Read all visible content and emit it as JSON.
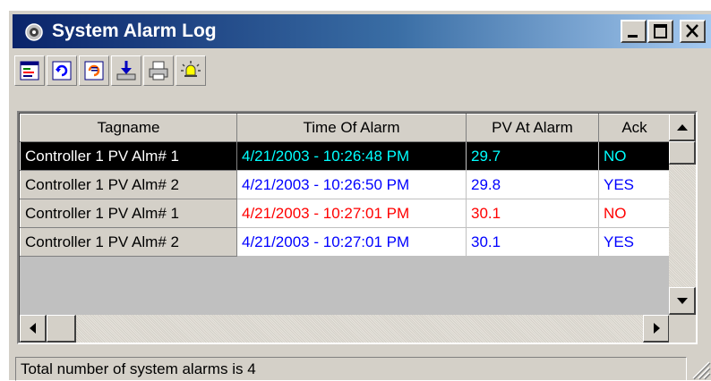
{
  "window": {
    "title": "System Alarm Log",
    "controls": [
      "minimize",
      "restore",
      "close"
    ]
  },
  "toolbar": {
    "buttons": [
      {
        "icon": "report-icon"
      },
      {
        "icon": "refresh-icon"
      },
      {
        "icon": "acknowledge-icon"
      },
      {
        "icon": "export-icon"
      },
      {
        "icon": "print-icon"
      },
      {
        "icon": "alarm-bell-icon"
      }
    ]
  },
  "grid": {
    "columns": [
      "Tagname",
      "Time Of Alarm",
      "PV At Alarm",
      "Ack"
    ],
    "rows": [
      {
        "tagname": "Controller 1 PV Alm# 1",
        "time": "4/21/2003 - 10:26:48 PM",
        "pv": "29.7",
        "ack": "NO",
        "color": "#00ffff",
        "selected": true
      },
      {
        "tagname": "Controller 1 PV Alm# 2",
        "time": "4/21/2003 - 10:26:50 PM",
        "pv": "29.8",
        "ack": "YES",
        "color": "#0000ff",
        "selected": false
      },
      {
        "tagname": "Controller 1 PV Alm# 1",
        "time": "4/21/2003 - 10:27:01 PM",
        "pv": "30.1",
        "ack": "NO",
        "color": "#ff0000",
        "selected": false
      },
      {
        "tagname": "Controller 1 PV Alm# 2",
        "time": "4/21/2003 - 10:27:01 PM",
        "pv": "30.1",
        "ack": "YES",
        "color": "#0000ff",
        "selected": false
      }
    ]
  },
  "status": {
    "text": "Total number of system alarms is 4"
  },
  "colors": {
    "titlebar_start": "#0a246a",
    "titlebar_end": "#a6caf0",
    "selected_row": "#000000"
  }
}
